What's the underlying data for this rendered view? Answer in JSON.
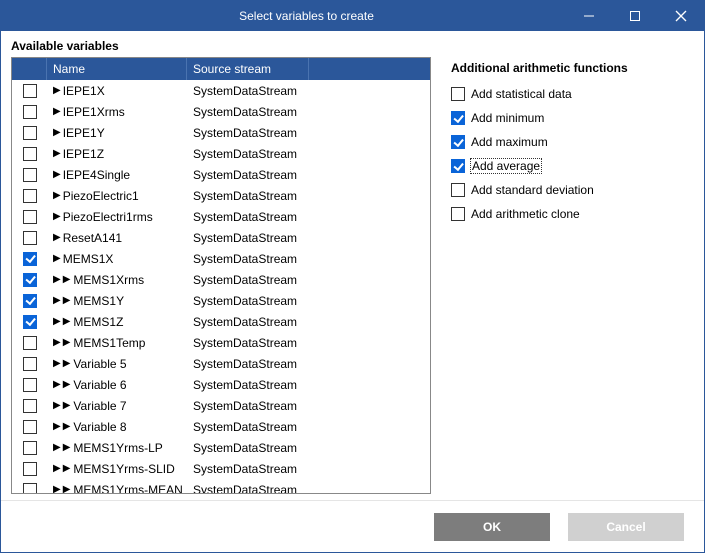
{
  "window": {
    "title": "Select variables to create"
  },
  "left_title": "Available variables",
  "columns": {
    "name": "Name",
    "source": "Source stream"
  },
  "rows": [
    {
      "checked": false,
      "depth": 1,
      "name": "IEPE1X",
      "source": "SystemDataStream"
    },
    {
      "checked": false,
      "depth": 1,
      "name": "IEPE1Xrms",
      "source": "SystemDataStream"
    },
    {
      "checked": false,
      "depth": 1,
      "name": "IEPE1Y",
      "source": "SystemDataStream"
    },
    {
      "checked": false,
      "depth": 1,
      "name": "IEPE1Z",
      "source": "SystemDataStream"
    },
    {
      "checked": false,
      "depth": 1,
      "name": "IEPE4Single",
      "source": "SystemDataStream"
    },
    {
      "checked": false,
      "depth": 1,
      "name": "PiezoElectric1",
      "source": "SystemDataStream"
    },
    {
      "checked": false,
      "depth": 1,
      "name": "PiezoElectri1rms",
      "source": "SystemDataStream"
    },
    {
      "checked": false,
      "depth": 1,
      "name": "ResetA141",
      "source": "SystemDataStream"
    },
    {
      "checked": true,
      "depth": 1,
      "name": "MEMS1X",
      "source": "SystemDataStream"
    },
    {
      "checked": true,
      "depth": 2,
      "name": "MEMS1Xrms",
      "source": "SystemDataStream"
    },
    {
      "checked": true,
      "depth": 2,
      "name": "MEMS1Y",
      "source": "SystemDataStream"
    },
    {
      "checked": true,
      "depth": 2,
      "name": "MEMS1Z",
      "source": "SystemDataStream"
    },
    {
      "checked": false,
      "depth": 2,
      "name": "MEMS1Temp",
      "source": "SystemDataStream"
    },
    {
      "checked": false,
      "depth": 2,
      "name": "Variable 5",
      "source": "SystemDataStream"
    },
    {
      "checked": false,
      "depth": 2,
      "name": "Variable 6",
      "source": "SystemDataStream"
    },
    {
      "checked": false,
      "depth": 2,
      "name": "Variable 7",
      "source": "SystemDataStream"
    },
    {
      "checked": false,
      "depth": 2,
      "name": "Variable 8",
      "source": "SystemDataStream"
    },
    {
      "checked": false,
      "depth": 2,
      "name": "MEMS1Yrms-LP",
      "source": "SystemDataStream"
    },
    {
      "checked": false,
      "depth": 2,
      "name": "MEMS1Yrms-SLID",
      "source": "SystemDataStream"
    },
    {
      "checked": false,
      "depth": 2,
      "name": "MEMS1Yrms-MEAN",
      "source": "SystemDataStream"
    }
  ],
  "functions_title": "Additional arithmetic functions",
  "functions": [
    {
      "label": "Add statistical data",
      "checked": false,
      "focused": false
    },
    {
      "label": "Add minimum",
      "checked": true,
      "focused": false
    },
    {
      "label": "Add maximum",
      "checked": true,
      "focused": false
    },
    {
      "label": "Add average",
      "checked": true,
      "focused": true
    },
    {
      "label": "Add standard deviation",
      "checked": false,
      "focused": false
    },
    {
      "label": "Add arithmetic clone",
      "checked": false,
      "focused": false
    }
  ],
  "buttons": {
    "ok": "OK",
    "cancel": "Cancel"
  }
}
